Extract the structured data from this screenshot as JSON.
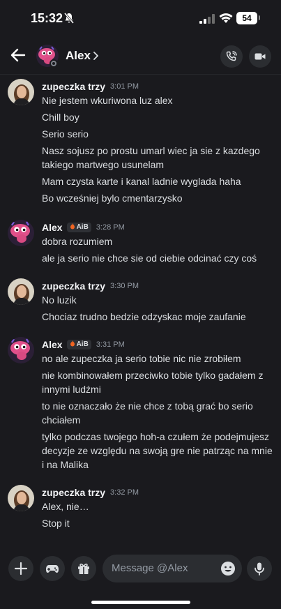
{
  "status": {
    "time": "15:32",
    "battery": "54"
  },
  "header": {
    "name": "Alex"
  },
  "groups": [
    {
      "user": "zupeczka trzy",
      "tag": "",
      "time": "3:01 PM",
      "avatar": "girl",
      "messages": [
        "Nie jestem wkuriwona luz alex",
        "Chill boy",
        "Serio serio",
        "Nasz sojusz po prostu umarl wiec ja sie z kazdego takiego martwego usunelam",
        "Mam czysta karte i kanal ladnie wyglada haha",
        "Bo wcześniej bylo cmentarzysko"
      ]
    },
    {
      "user": "Alex",
      "tag": "AiB",
      "time": "3:28 PM",
      "avatar": "alien",
      "messages": [
        "dobra rozumiem",
        "ale ja serio nie chce sie od ciebie odcinać czy coś"
      ]
    },
    {
      "user": "zupeczka trzy",
      "tag": "",
      "time": "3:30 PM",
      "avatar": "girl",
      "messages": [
        "No luzik",
        "Chociaz trudno bedzie odzyskac moje zaufanie"
      ]
    },
    {
      "user": "Alex",
      "tag": "AiB",
      "time": "3:31 PM",
      "avatar": "alien",
      "messages": [
        "no ale zupeczka ja serio tobie nic nie zrobiłem",
        "nie kombinowałem przeciwko tobie tylko gadałem z innymi ludźmi",
        "to nie oznaczało że nie chce z tobą grać bo serio chciałem",
        "tylko podczas twojego hoh-a czułem że podejmujesz decyzje ze względu na swoją gre nie patrząc na mnie i na Malika"
      ]
    },
    {
      "user": "zupeczka trzy",
      "tag": "",
      "time": "3:32 PM",
      "avatar": "girl",
      "messages": [
        "Alex, nie…",
        "Stop it"
      ]
    }
  ],
  "composer": {
    "placeholder": "Message @Alex"
  },
  "colors": {
    "background": "#1a1a1e",
    "button_bg": "#2b2d31",
    "text": "#dbdee1",
    "muted": "#949ba4"
  },
  "icons": [
    "back-arrow-icon",
    "chevron-right-icon",
    "phone-call-icon",
    "video-icon",
    "plus-icon",
    "gamepad-icon",
    "gift-icon",
    "emoji-icon",
    "microphone-icon",
    "bell-muted-icon",
    "signal-icon",
    "wifi-icon",
    "battery-icon"
  ]
}
